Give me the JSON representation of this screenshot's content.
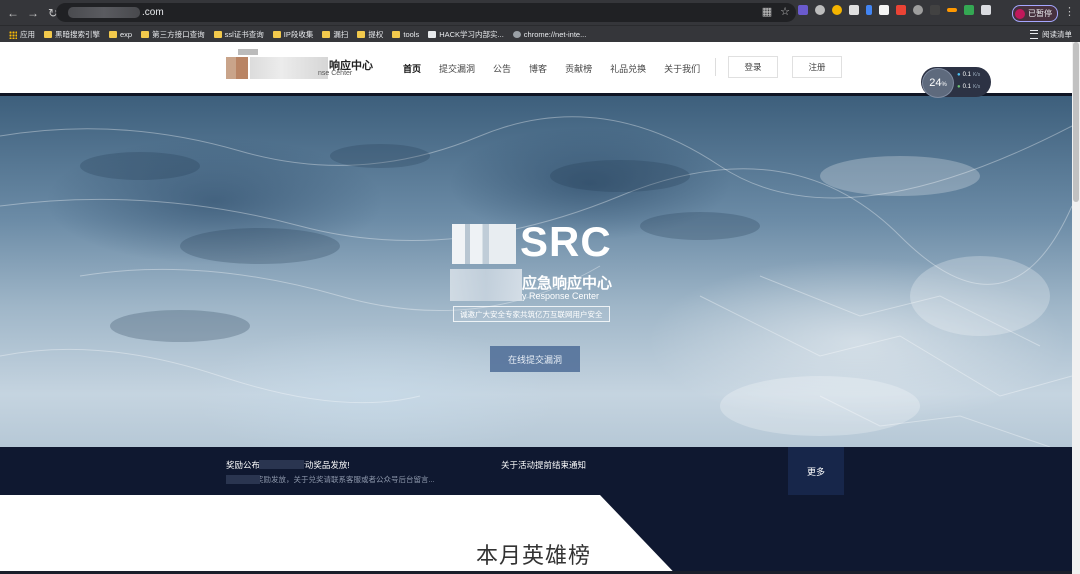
{
  "browser": {
    "url_suffix": ".com",
    "profile_label": "已暂停",
    "bookmarks": [
      {
        "label": "应用",
        "icon": "apps-grid-icon"
      },
      {
        "label": "黑暗搜索引擎",
        "icon": "folder-icon"
      },
      {
        "label": "exp",
        "icon": "folder-icon"
      },
      {
        "label": "第三方接口查询",
        "icon": "folder-icon"
      },
      {
        "label": "ssl证书查询",
        "icon": "folder-icon"
      },
      {
        "label": "IP段收集",
        "icon": "folder-icon"
      },
      {
        "label": "漏扫",
        "icon": "folder-icon"
      },
      {
        "label": "提权",
        "icon": "folder-icon"
      },
      {
        "label": "tools",
        "icon": "folder-icon"
      },
      {
        "label": "HACK学习内部实...",
        "icon": "page-icon"
      },
      {
        "label": "chrome://net-inte...",
        "icon": "globe-icon"
      }
    ],
    "reading_list": "阅读清单"
  },
  "site": {
    "logo_name": "响应中心",
    "logo_sub": "nse Center",
    "nav": [
      "首页",
      "提交漏洞",
      "公告",
      "博客",
      "贡献榜",
      "礼品兑换",
      "关于我们"
    ],
    "login": "登录",
    "register": "注册"
  },
  "speed_widget": {
    "percent": "24",
    "percent_unit": "%",
    "up": "0.1",
    "down": "0.1",
    "unit": "K/s"
  },
  "hero": {
    "title": "SRC",
    "subtitle_cn": "应急响应中心",
    "subtitle_en": "y Response Center",
    "slogan": "诚邀广大安全专家共筑亿万互联网用户安全",
    "cta": "在线提交漏洞"
  },
  "announcements": {
    "item1_title": "奖励公布   期次上线活动奖品发放!",
    "item1_desc": "上线活动奖励发放，关于兑奖请联系客服或者公众号后台留言...",
    "item2_title": "关于活动提前结束通知",
    "more": "更多"
  },
  "section": {
    "heroes_title": "本月英雄榜"
  },
  "colors": {
    "dark_navy": "#0f1830",
    "browser_bar": "#35363a",
    "cta_blue": "#4e6c96"
  }
}
